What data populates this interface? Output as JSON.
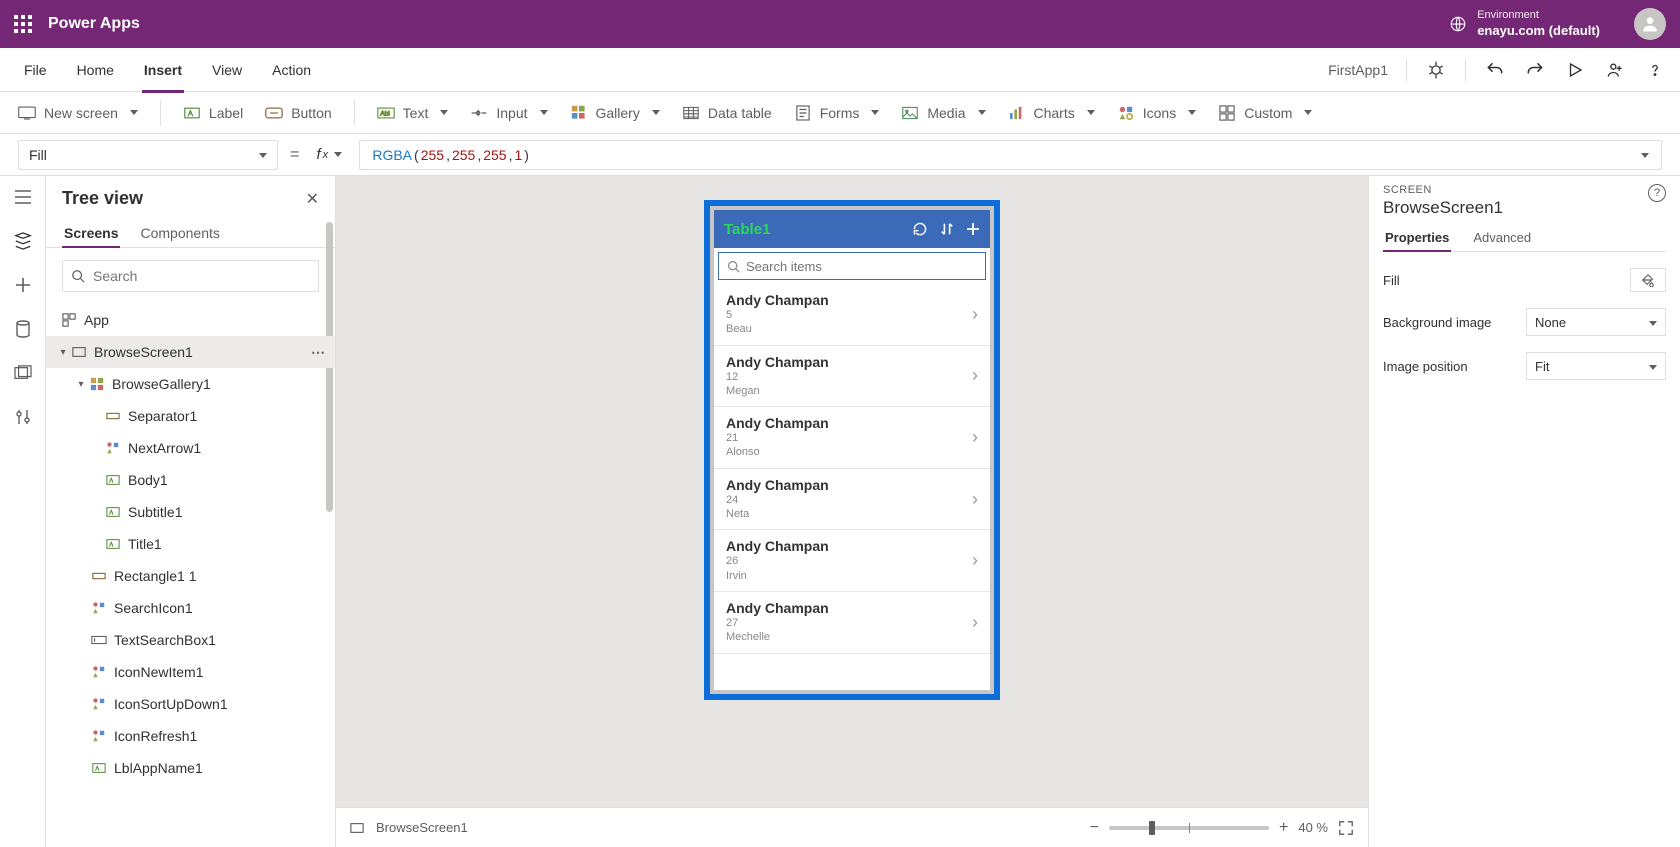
{
  "header": {
    "brand": "Power Apps",
    "env_label": "Environment",
    "env_name": "enayu.com (default)"
  },
  "menu": {
    "items": [
      "File",
      "Home",
      "Insert",
      "View",
      "Action"
    ],
    "active_index": 2,
    "app_name": "FirstApp1"
  },
  "ribbon": {
    "new_screen": "New screen",
    "label": "Label",
    "button": "Button",
    "text": "Text",
    "input": "Input",
    "gallery": "Gallery",
    "data_table": "Data table",
    "forms": "Forms",
    "media": "Media",
    "charts": "Charts",
    "icons": "Icons",
    "custom": "Custom"
  },
  "formula": {
    "property": "Fill",
    "fn": "RGBA",
    "args": [
      "255",
      "255",
      "255",
      "1"
    ]
  },
  "tree": {
    "title": "Tree view",
    "tab_screens": "Screens",
    "tab_components": "Components",
    "search_placeholder": "Search",
    "app_node": "App",
    "selected": "BrowseScreen1",
    "gallery": "BrowseGallery1",
    "children": [
      "Separator1",
      "NextArrow1",
      "Body1",
      "Subtitle1",
      "Title1"
    ],
    "after": [
      "Rectangle1 1",
      "SearchIcon1",
      "TextSearchBox1",
      "IconNewItem1",
      "IconSortUpDown1",
      "IconRefresh1",
      "LblAppName1"
    ]
  },
  "phone": {
    "title": "Table1",
    "search_placeholder": "Search items",
    "rows": [
      {
        "title": "Andy Champan",
        "n": "5",
        "sub": "Beau"
      },
      {
        "title": "Andy Champan",
        "n": "12",
        "sub": "Megan"
      },
      {
        "title": "Andy Champan",
        "n": "21",
        "sub": "Alonso"
      },
      {
        "title": "Andy Champan",
        "n": "24",
        "sub": "Neta"
      },
      {
        "title": "Andy Champan",
        "n": "26",
        "sub": "Irvin"
      },
      {
        "title": "Andy Champan",
        "n": "27",
        "sub": "Mechelle"
      }
    ]
  },
  "status": {
    "screen_label": "BrowseScreen1",
    "zoom": "40 %"
  },
  "props": {
    "head_label": "SCREEN",
    "head_name": "BrowseScreen1",
    "tab_properties": "Properties",
    "tab_advanced": "Advanced",
    "fill_label": "Fill",
    "bg_label": "Background image",
    "bg_value": "None",
    "pos_label": "Image position",
    "pos_value": "Fit"
  }
}
